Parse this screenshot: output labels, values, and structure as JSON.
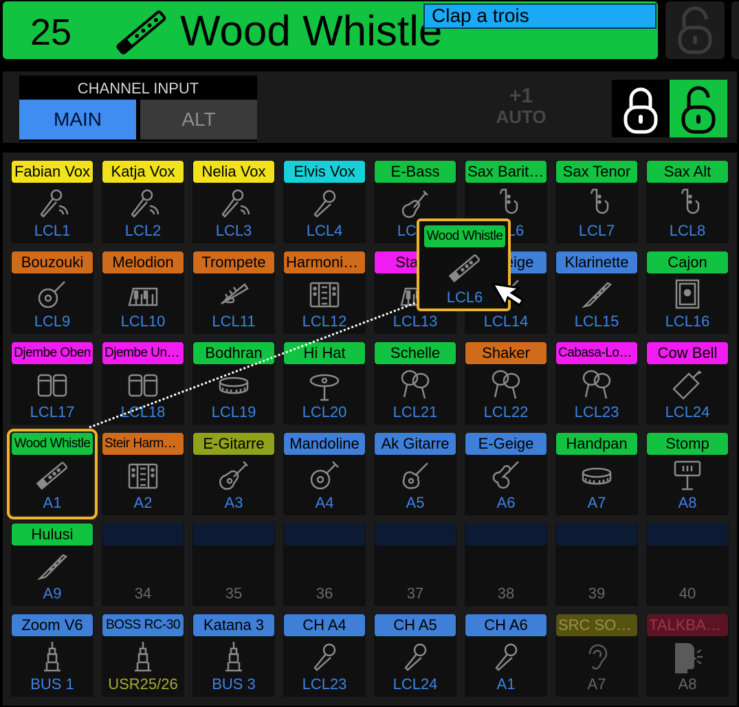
{
  "header": {
    "channel_number": "25",
    "channel_name": "Wood Whistle",
    "name_input_value": "Clap a trois",
    "header_color": "#12c341"
  },
  "input_bar": {
    "channel_input_label": "CHANNEL INPUT",
    "main_label": "MAIN",
    "alt_label": "ALT",
    "auto_plus": "+1",
    "auto_label": "AUTO"
  },
  "colors": {
    "green": "#12c341",
    "yellow": "#f2e21a",
    "cyan": "#16d2d8",
    "orange": "#d06b1c",
    "magenta": "#f11cf1",
    "blue": "#3f7fd8",
    "olive": "#8fa21a",
    "dim_olive": "#555212",
    "dim_red": "#5a1424",
    "selection": "#f0b429"
  },
  "grid": {
    "rows": [
      [
        {
          "label": "Fabian Vox",
          "color": "yellow",
          "icon": "wireless-mic-icon",
          "source": "LCL1"
        },
        {
          "label": "Katja Vox",
          "color": "yellow",
          "icon": "wireless-mic-icon",
          "source": "LCL2"
        },
        {
          "label": "Nelia Vox",
          "color": "yellow",
          "icon": "wireless-mic-icon",
          "source": "LCL3"
        },
        {
          "label": "Elvis Vox",
          "color": "cyan",
          "icon": "microphone-icon",
          "source": "LCL4"
        },
        {
          "label": "E-Bass",
          "color": "green",
          "icon": "bass-guitar-icon",
          "source": "LCL5"
        },
        {
          "label": "Sax Bariton",
          "color": "green",
          "icon": "saxophone-icon",
          "source": "LCL6"
        },
        {
          "label": "Sax Tenor",
          "color": "green",
          "icon": "saxophone-icon",
          "source": "LCL7"
        },
        {
          "label": "Sax Alt",
          "color": "green",
          "icon": "saxophone-icon",
          "source": "LCL8"
        }
      ],
      [
        {
          "label": "Bouzouki",
          "color": "orange",
          "icon": "bouzouki-icon",
          "source": "LCL9"
        },
        {
          "label": "Melodion",
          "color": "orange",
          "icon": "keyboard-icon",
          "source": "LCL10"
        },
        {
          "label": "Trompete",
          "color": "orange",
          "icon": "trumpet-icon",
          "source": "LCL11"
        },
        {
          "label": "Harmonium",
          "color": "orange",
          "icon": "accordion-icon",
          "source": "LCL12"
        },
        {
          "label": "Stage",
          "color": "magenta",
          "icon": "keyboard-icon",
          "source": "LCL13"
        },
        {
          "label": "E-Geige",
          "color": "blue",
          "icon": "violin-icon",
          "source": "LCL14"
        },
        {
          "label": "Klarinette",
          "color": "blue",
          "icon": "clarinet-icon",
          "source": "LCL15"
        },
        {
          "label": "Cajon",
          "color": "green",
          "icon": "cajon-icon",
          "source": "LCL16"
        }
      ],
      [
        {
          "label": "Djembe Oben",
          "color": "magenta",
          "icon": "drums-icon",
          "source": "LCL17",
          "narrow": true
        },
        {
          "label": "Djembe Unten",
          "color": "magenta",
          "icon": "drums-icon",
          "source": "LCL18",
          "narrow": true
        },
        {
          "label": "Bodhran",
          "color": "green",
          "icon": "frame-drum-icon",
          "source": "LCL19"
        },
        {
          "label": "Hi Hat",
          "color": "green",
          "icon": "hihat-icon",
          "source": "LCL20"
        },
        {
          "label": "Schelle",
          "color": "green",
          "icon": "maracas-icon",
          "source": "LCL21"
        },
        {
          "label": "Shaker",
          "color": "orange",
          "icon": "maracas-icon",
          "source": "LCL22"
        },
        {
          "label": "Cabasa-Loewe",
          "color": "magenta",
          "icon": "maracas-icon",
          "source": "LCL23",
          "narrow": true
        },
        {
          "label": "Cow Bell",
          "color": "magenta",
          "icon": "cowbell-icon",
          "source": "LCL24"
        }
      ],
      [
        {
          "label": "Wood Whistle",
          "color": "green",
          "icon": "whistle-icon",
          "source": "A1",
          "narrow": true,
          "selected": true
        },
        {
          "label": "Steir Harmonika",
          "color": "orange",
          "icon": "accordion-icon",
          "source": "A2",
          "narrow": true
        },
        {
          "label": "E-Gitarre",
          "color": "olive",
          "icon": "guitar-icon",
          "source": "A3"
        },
        {
          "label": "Mandoline",
          "color": "blue",
          "icon": "mandolin-icon",
          "source": "A4"
        },
        {
          "label": "Ak Gitarre",
          "color": "blue",
          "icon": "acoustic-guitar-icon",
          "source": "A5"
        },
        {
          "label": "E-Geige",
          "color": "blue",
          "icon": "violin-icon",
          "source": "A6"
        },
        {
          "label": "Handpan",
          "color": "green",
          "icon": "frame-drum-icon",
          "source": "A7"
        },
        {
          "label": "Stomp",
          "color": "green",
          "icon": "stomp-icon",
          "source": "A8"
        }
      ],
      [
        {
          "label": "Hulusi",
          "color": "green",
          "icon": "clarinet-icon",
          "source": "A9"
        },
        {
          "label": "",
          "color": "empty",
          "icon": "",
          "source": "34"
        },
        {
          "label": "",
          "color": "empty",
          "icon": "",
          "source": "35"
        },
        {
          "label": "",
          "color": "empty",
          "icon": "",
          "source": "36"
        },
        {
          "label": "",
          "color": "empty",
          "icon": "",
          "source": "37"
        },
        {
          "label": "",
          "color": "empty",
          "icon": "",
          "source": "38"
        },
        {
          "label": "",
          "color": "empty",
          "icon": "",
          "source": "39"
        },
        {
          "label": "",
          "color": "empty",
          "icon": "",
          "source": "40"
        }
      ],
      [
        {
          "label": "Zoom V6",
          "color": "blue",
          "icon": "jack-icon",
          "source": "BUS 1"
        },
        {
          "label": "BOSS RC-30",
          "color": "blue",
          "icon": "jack-icon",
          "source": "USR25/26",
          "narrow": true,
          "src_style": "yellow"
        },
        {
          "label": "Katana 3",
          "color": "blue",
          "icon": "jack-icon",
          "source": "BUS 3"
        },
        {
          "label": "CH A4",
          "color": "blue",
          "icon": "microphone-icon",
          "source": "LCL23"
        },
        {
          "label": "CH A5",
          "color": "blue",
          "icon": "microphone-icon",
          "source": "LCL24"
        },
        {
          "label": "CH A6",
          "color": "blue",
          "icon": "microphone-icon",
          "source": "A1"
        },
        {
          "label": "SRC SOLO",
          "color": "dim_olive",
          "icon": "ear-icon",
          "source": "A7",
          "src_style": "gray",
          "dim": true
        },
        {
          "label": "TALKBACK",
          "color": "dim_red",
          "icon": "talkback-icon",
          "source": "A8",
          "src_style": "gray",
          "dim": true
        }
      ]
    ]
  },
  "drag_ghost": {
    "label": "Wood Whistle",
    "source": "LCL6",
    "icon": "whistle-icon"
  }
}
